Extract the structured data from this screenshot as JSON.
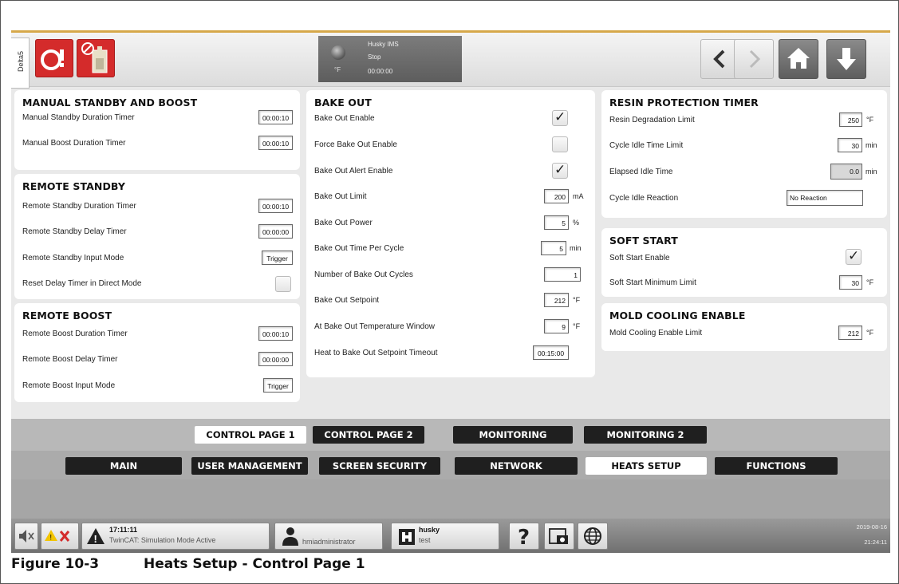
{
  "header": {
    "side_tab": "Delta5",
    "status": {
      "line1": "Husky IMS",
      "line2": "Stop",
      "line3": "00:00:00",
      "unit": "°F"
    }
  },
  "manual_standby_boost": {
    "title": "MANUAL STANDBY AND BOOST",
    "rows": [
      {
        "label": "Manual Standby Duration Timer",
        "value": "00:00:10"
      },
      {
        "label": "Manual Boost Duration Timer",
        "value": "00:00:10"
      }
    ]
  },
  "remote_standby": {
    "title": "REMOTE STANDBY",
    "rows": [
      {
        "label": "Remote Standby Duration Timer",
        "value": "00:00:10"
      },
      {
        "label": "Remote Standby Delay Timer",
        "value": "00:00:00"
      },
      {
        "label": "Remote Standby Input Mode",
        "value": "Trigger"
      },
      {
        "label": "Reset Delay Timer in Direct Mode",
        "checked": false
      }
    ]
  },
  "remote_boost": {
    "title": "REMOTE BOOST",
    "rows": [
      {
        "label": "Remote Boost Duration Timer",
        "value": "00:00:10"
      },
      {
        "label": "Remote Boost Delay Timer",
        "value": "00:00:00"
      },
      {
        "label": "Remote Boost Input Mode",
        "value": "Trigger"
      }
    ]
  },
  "bake_out": {
    "title": "BAKE OUT",
    "rows": [
      {
        "label": "Bake Out Enable",
        "checked": true
      },
      {
        "label": "Force Bake Out Enable",
        "checked": false
      },
      {
        "label": "Bake Out Alert Enable",
        "checked": true
      },
      {
        "label": "Bake Out Limit",
        "value": "200",
        "unit": "mA"
      },
      {
        "label": "Bake Out Power",
        "value": "5",
        "unit": "%"
      },
      {
        "label": "Bake Out Time Per Cycle",
        "value": "5",
        "unit": "min"
      },
      {
        "label": "Number of Bake Out Cycles",
        "value": "1"
      },
      {
        "label": "Bake Out Setpoint",
        "value": "212",
        "unit": "°F"
      },
      {
        "label": "At Bake Out Temperature Window",
        "value": "9",
        "unit": "°F"
      },
      {
        "label": "Heat to Bake Out Setpoint Timeout",
        "value": "00:15:00"
      }
    ]
  },
  "resin_protection": {
    "title": "RESIN PROTECTION TIMER",
    "rows": [
      {
        "label": "Resin Degradation Limit",
        "value": "250",
        "unit": "°F"
      },
      {
        "label": "Cycle Idle Time Limit",
        "value": "30",
        "unit": "min"
      },
      {
        "label": "Elapsed Idle Time",
        "value": "0.0",
        "unit": "min"
      },
      {
        "label": "Cycle Idle Reaction",
        "value": "No Reaction"
      }
    ]
  },
  "soft_start": {
    "title": "SOFT START",
    "rows": [
      {
        "label": "Soft Start Enable",
        "checked": true
      },
      {
        "label": "Soft Start Minimum Limit",
        "value": "30",
        "unit": "°F"
      }
    ]
  },
  "mold_cooling": {
    "title": "MOLD COOLING ENABLE",
    "rows": [
      {
        "label": "Mold Cooling Enable Limit",
        "value": "212",
        "unit": "°F"
      }
    ]
  },
  "page_tabs": [
    "CONTROL PAGE 1",
    "CONTROL PAGE 2",
    "MONITORING",
    "MONITORING 2"
  ],
  "section_tabs": [
    "MAIN",
    "USER MANAGEMENT",
    "SCREEN SECURITY",
    "NETWORK",
    "HEATS SETUP",
    "FUNCTIONS"
  ],
  "bottom": {
    "alarm_time": "17:11:11",
    "alarm_text": "TwinCAT: Simulation Mode Active",
    "user": "hmiadministrator",
    "machine_name": "husky",
    "machine_sub": "test",
    "date": "2019-08-16",
    "time": "21:24:11"
  },
  "figure": {
    "label": "Figure 10-3",
    "title": "Heats Setup - Control Page 1"
  },
  "colors": {
    "accent": "#d6a84a",
    "alarm_red": "#d42b2b",
    "tab_dark": "#1f1f1f"
  }
}
